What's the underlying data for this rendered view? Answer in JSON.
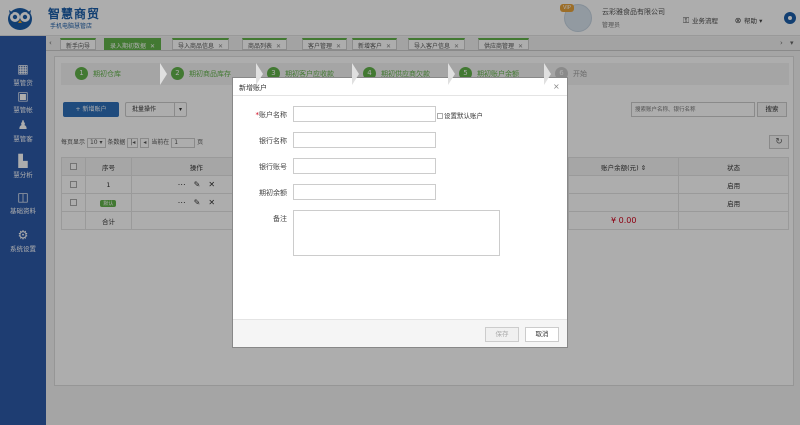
{
  "header": {
    "logo_title": "智慧商贸",
    "logo_subtitle": "手机电脑慧管店",
    "vip_badge": "VIP",
    "company_name": "云彩雅食品有限公司",
    "role": "管理员",
    "links": [
      {
        "icon": "org-chart-icon",
        "label": "业务流程"
      },
      {
        "icon": "help-icon",
        "label": "帮助"
      }
    ]
  },
  "sidebar": {
    "items": [
      {
        "icon": "shop-icon",
        "label": "慧管货"
      },
      {
        "icon": "wallet-icon",
        "label": "慧管帐"
      },
      {
        "icon": "users-icon",
        "label": "慧管客"
      },
      {
        "icon": "bar-chart-icon",
        "label": "慧分析"
      },
      {
        "icon": "book-icon",
        "label": "基础资料"
      },
      {
        "icon": "gear-icon",
        "label": "系统设置"
      }
    ]
  },
  "tabs": [
    {
      "label": "新手向导",
      "active": false
    },
    {
      "label": "录入期初数据",
      "active": true
    },
    {
      "label": "导入商品信息",
      "active": false
    },
    {
      "label": "商品列表",
      "active": false
    },
    {
      "label": "客户管理",
      "active": false
    },
    {
      "label": "新增客户",
      "active": false
    },
    {
      "label": "导入客户信息",
      "active": false
    },
    {
      "label": "供应商管理",
      "active": false
    }
  ],
  "steps": [
    {
      "num": "1",
      "label": "期初仓库",
      "done": true
    },
    {
      "num": "2",
      "label": "期初商品库存",
      "done": true
    },
    {
      "num": "3",
      "label": "期初客户应收款",
      "done": true
    },
    {
      "num": "4",
      "label": "期初供应商欠款",
      "done": true
    },
    {
      "num": "5",
      "label": "期初账户余额",
      "done": true
    },
    {
      "num": "6",
      "label": "开始",
      "done": false
    }
  ],
  "toolbar": {
    "add_label": "+ 新增账户",
    "batch_label": "批量操作",
    "search_placeholder": "搜索账户名称、银行名称",
    "search_label": "搜索"
  },
  "pager": {
    "per_page_label": "每页显示",
    "per_page_value": "10",
    "unit_label": "条数据",
    "current_label": "当前在",
    "current_page": "1",
    "page_label": "页"
  },
  "table": {
    "headers": [
      "序号",
      "操作",
      "账户余额(元)",
      "状态"
    ],
    "rows": [
      {
        "index": "1",
        "badge": "",
        "status": "启用"
      },
      {
        "index": "",
        "badge": "默认",
        "status": "启用"
      }
    ],
    "total_label": "合计",
    "total_value": "¥ 0.00"
  },
  "modal": {
    "title": "新增账户",
    "fields": [
      {
        "label": "账户名称",
        "required": true
      },
      {
        "label": "银行名称",
        "required": false
      },
      {
        "label": "银行账号",
        "required": false
      },
      {
        "label": "期初余额",
        "required": false
      },
      {
        "label": "备注",
        "required": false
      }
    ],
    "default_checkbox_label": "设置默认账户",
    "required_mark": "*",
    "save_label": "保存",
    "cancel_label": "取消"
  },
  "colors": {
    "brand_blue": "#2d5aa8",
    "accent_green": "#62b34a",
    "danger_red": "#d0021b"
  }
}
